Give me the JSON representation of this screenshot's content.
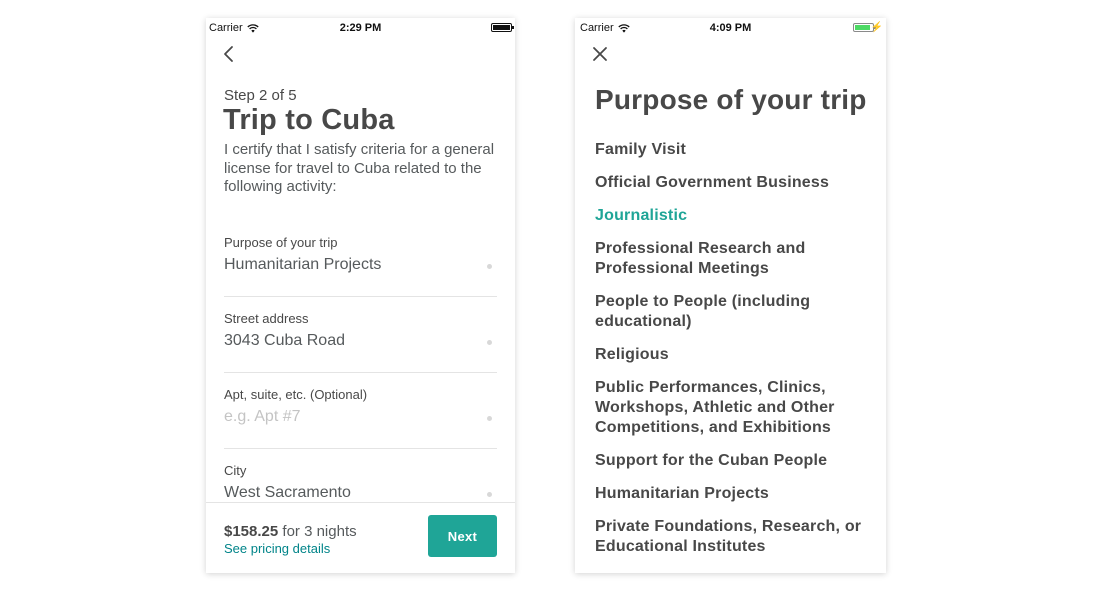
{
  "status_left": {
    "carrier": "Carrier",
    "time": "2:29 PM"
  },
  "status_right": {
    "carrier": "Carrier",
    "time": "4:09 PM"
  },
  "form": {
    "step": "Step 2 of 5",
    "title": "Trip to Cuba",
    "description": "I certify that I satisfy criteria for a general license for travel to Cuba related to the following activity:",
    "fields": [
      {
        "label": "Purpose of your trip",
        "value": "Humanitarian Projects",
        "placeholder": ""
      },
      {
        "label": "Street address",
        "value": "3043 Cuba Road",
        "placeholder": ""
      },
      {
        "label": "Apt, suite, etc. (Optional)",
        "value": "",
        "placeholder": "e.g. Apt #7"
      },
      {
        "label": "City",
        "value": "West Sacramento",
        "placeholder": ""
      }
    ],
    "footer": {
      "price": "$158.25",
      "price_suffix": " for 3 nights",
      "pricing_link": "See pricing details",
      "next_label": "Next"
    }
  },
  "purpose_picker": {
    "title": "Purpose of your trip",
    "selected_index": 2,
    "options": [
      "Family Visit",
      "Official Government Business",
      "Journalistic",
      "Professional Research and Professional Meetings",
      "People to People (including educational)",
      "Religious",
      "Public Performances, Clinics, Workshops, Athletic and Other Competitions, and Exhibitions",
      "Support for the Cuban People",
      "Humanitarian Projects",
      "Private Foundations, Research, or Educational Institutes"
    ]
  },
  "colors": {
    "accent": "#1fa597",
    "link": "#008489",
    "text": "#484848",
    "battery_charging": "#4cd964"
  },
  "battery": {
    "left_level": 1.0,
    "right_level": 0.9,
    "right_charging": true
  },
  "icons": {
    "back": "chevron-left-icon",
    "close": "close-icon",
    "wifi": "wifi-icon",
    "battery": "battery-icon"
  }
}
